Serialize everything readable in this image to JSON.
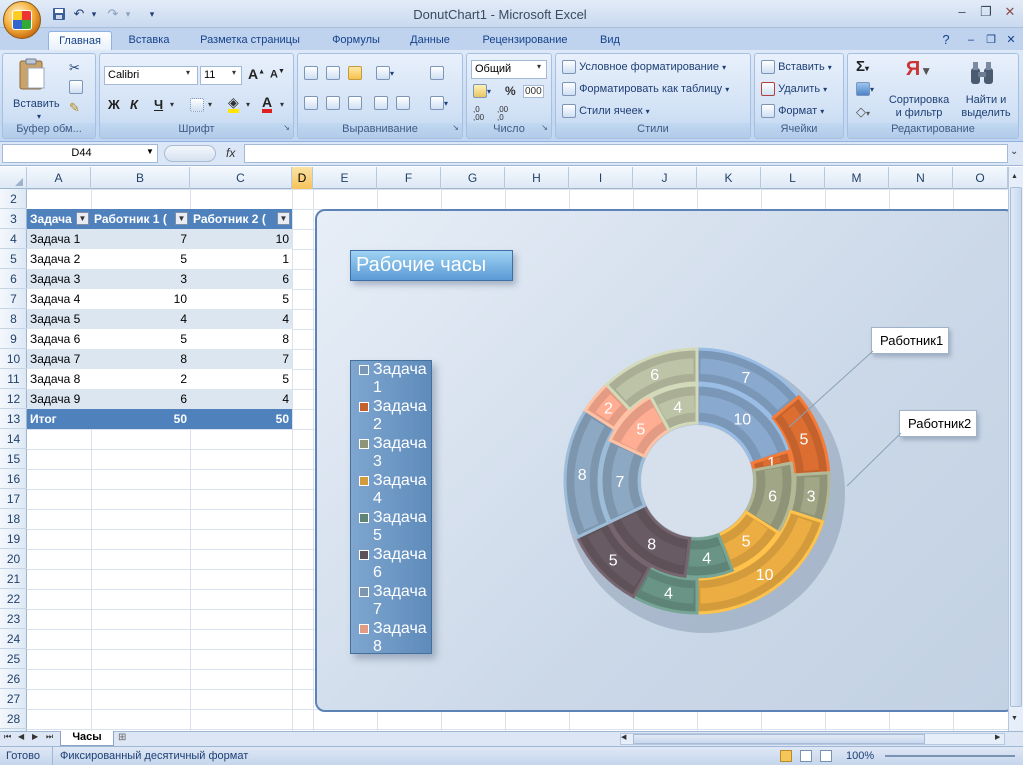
{
  "window": {
    "title": "DonutChart1 - Microsoft Excel",
    "minimize": "–",
    "restore": "❐",
    "close": "✕"
  },
  "qat": {
    "save_icon": "save-icon",
    "undo": "↶",
    "redo": "↷",
    "more": "▾"
  },
  "tabs": [
    "Главная",
    "Вставка",
    "Разметка страницы",
    "Формулы",
    "Данные",
    "Рецензирование",
    "Вид"
  ],
  "active_tab": "Главная",
  "ribbon": {
    "clipboard": {
      "label": "Буфер обм...",
      "paste": "Вставить"
    },
    "font": {
      "label": "Шрифт",
      "name": "Calibri",
      "size": "11",
      "grow": "A",
      "shrink": "A",
      "bold": "Ж",
      "italic": "К",
      "underline": "Ч",
      "color_letter": "A"
    },
    "alignment": {
      "label": "Выравнивание"
    },
    "number": {
      "label": "Число",
      "format": "Общий",
      "percent": "%",
      "thousands": "000",
      "inc_dec": ",0\n,00",
      "dec_dec": ",00\n,0"
    },
    "styles": {
      "label": "Стили",
      "conditional": "Условное форматирование",
      "as_table": "Форматировать как таблицу",
      "cell_styles": "Стили ячеек"
    },
    "cells": {
      "label": "Ячейки",
      "insert": "Вставить",
      "delete": "Удалить",
      "format": "Формат"
    },
    "editing": {
      "label": "Редактирование",
      "sum": "Σ",
      "sort": "Сортировка\nи фильтр",
      "find": "Найти и\nвыделить"
    }
  },
  "formula_bar": {
    "name_box": "D44",
    "fx": "fx",
    "value": ""
  },
  "columns": [
    "A",
    "B",
    "C",
    "D",
    "E",
    "F",
    "G",
    "H",
    "I",
    "J",
    "K",
    "L",
    "M",
    "N",
    "O"
  ],
  "selected_column": "D",
  "rows": [
    "2",
    "3",
    "4",
    "5",
    "6",
    "7",
    "8",
    "9",
    "10",
    "11",
    "12",
    "13",
    "14",
    "15",
    "16",
    "17",
    "18",
    "19",
    "20",
    "21",
    "22",
    "23",
    "24",
    "25",
    "26",
    "27",
    "28"
  ],
  "table": {
    "headers": [
      "Задача",
      "Работник 1 (",
      "Работник 2 ("
    ],
    "rows": [
      [
        "Задача 1",
        "7",
        "10"
      ],
      [
        "Задача 2",
        "5",
        "1"
      ],
      [
        "Задача 3",
        "3",
        "6"
      ],
      [
        "Задача 4",
        "10",
        "5"
      ],
      [
        "Задача 5",
        "4",
        "4"
      ],
      [
        "Задача 6",
        "5",
        "8"
      ],
      [
        "Задача 7",
        "8",
        "7"
      ],
      [
        "Задача 8",
        "2",
        "5"
      ],
      [
        "Задача 9",
        "6",
        "4"
      ]
    ],
    "total": [
      "Итог",
      "50",
      "50"
    ]
  },
  "chart_data": {
    "type": "pie",
    "title": "Рабочие часы",
    "categories": [
      "Задача 1",
      "Задача 2",
      "Задача 3",
      "Задача 4",
      "Задача 5",
      "Задача 6",
      "Задача 7",
      "Задача 8",
      "Задача 9"
    ],
    "series": [
      {
        "name": "Работник1",
        "values": [
          7,
          5,
          3,
          10,
          4,
          5,
          8,
          2,
          6
        ]
      },
      {
        "name": "Работник2",
        "values": [
          10,
          1,
          6,
          5,
          4,
          8,
          7,
          5,
          4
        ]
      }
    ],
    "legend_visible": [
      "Задача 1",
      "Задача 2",
      "Задача 3",
      "Задача 4",
      "Задача 5",
      "Задача 6",
      "Задача 7",
      "Задача 8"
    ],
    "colors": [
      "#7b97b8",
      "#c4622d",
      "#8f9478",
      "#d39b3b",
      "#5e8478",
      "#5e5158",
      "#7d96ad",
      "#e49b83",
      "#a9ae95"
    ],
    "legend": "left"
  },
  "sheet_tabs": [
    "Часы"
  ],
  "status": {
    "ready": "Готово",
    "mode": "Фиксированный десятичный формат",
    "zoom": "100%"
  }
}
